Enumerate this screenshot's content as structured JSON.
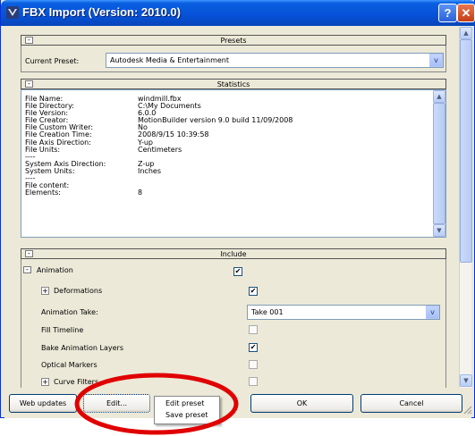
{
  "window": {
    "title": "FBX Import (Version: 2010.0)",
    "help_label": "?",
    "close_label": "✕"
  },
  "icons": {
    "app": "max-logo-icon",
    "scroll_up": "▲",
    "scroll_down": "▼",
    "dropdown": "v"
  },
  "presets": {
    "header": "Presets",
    "toggle": "-",
    "current_label": "Current Preset:",
    "current_value": "Autodesk Media & Entertainment"
  },
  "statistics": {
    "header": "Statistics",
    "toggle": "-",
    "rows": [
      {
        "k": "File Name:",
        "v": "windmill.fbx"
      },
      {
        "k": "File Directory:",
        "v": "C:\\My Documents"
      },
      {
        "k": "File Version:",
        "v": "6.0.0"
      },
      {
        "k": "File Creator:",
        "v": "MotionBuilder version 9.0 build 11/09/2008"
      },
      {
        "k": "File Custom Writer:",
        "v": "No"
      },
      {
        "k": "File Creation Time:",
        "v": "2008/9/15  10:39:58"
      },
      {
        "k": "File Axis Direction:",
        "v": "Y-up"
      },
      {
        "k": "File Units:",
        "v": "Centimeters"
      },
      {
        "k": "----",
        "v": ""
      },
      {
        "k": "System Axis Direction:",
        "v": "Z-up"
      },
      {
        "k": "System Units:",
        "v": "Inches"
      },
      {
        "k": "----",
        "v": ""
      },
      {
        "k": "File content:",
        "v": ""
      },
      {
        "k": "Elements:",
        "v": "8"
      }
    ]
  },
  "include": {
    "header": "Include",
    "toggle": "-",
    "animation": {
      "label": "Animation",
      "toggle": "-",
      "checked": "✔"
    },
    "deformations": {
      "label": "Deformations",
      "toggle": "+",
      "checked": "✔"
    },
    "take": {
      "label": "Animation Take:",
      "value": "Take 001"
    },
    "fill_timeline": {
      "label": "Fill Timeline",
      "checked": ""
    },
    "bake": {
      "label": "Bake Animation Layers",
      "checked": "✔"
    },
    "optical": {
      "label": "Optical Markers",
      "checked": ""
    },
    "curve_filters": {
      "label": "Curve Filters",
      "toggle": "+",
      "checked": ""
    }
  },
  "footer": {
    "web_updates": "Web updates",
    "edit": "Edit...",
    "ok": "OK",
    "cancel": "Cancel"
  },
  "edit_menu": [
    "Edit preset",
    "Save preset"
  ],
  "colors": {
    "title_bar": "#0651d8",
    "face": "#ece9d8",
    "annotation": "#e00000"
  }
}
